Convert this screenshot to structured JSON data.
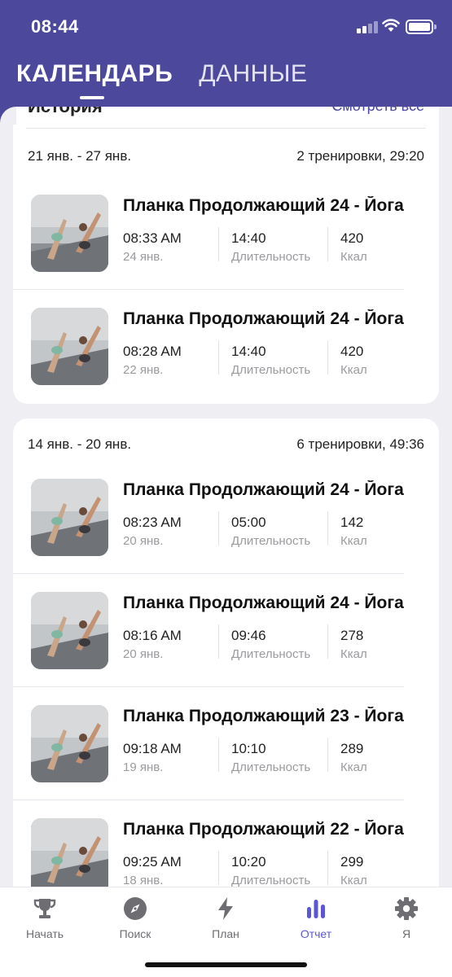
{
  "status_bar": {
    "time": "08:44"
  },
  "header": {
    "tabs": [
      {
        "label": "КАЛЕНДАРЬ",
        "active": true
      },
      {
        "label": "ДАННЫЕ",
        "active": false
      }
    ]
  },
  "history": {
    "title": "История",
    "link": "Смотреть все"
  },
  "weeks": [
    {
      "range": "21 янв. - 27 янв.",
      "summary": "2 тренировки, 29:20",
      "workouts": [
        {
          "title": "Планка Продолжающий 24 - Йога",
          "time": "08:33 AM",
          "date": "24 янв.",
          "duration": "14:40",
          "duration_label": "Длительность",
          "kcal": "420",
          "kcal_label": "Ккал"
        },
        {
          "title": "Планка Продолжающий 24 - Йога",
          "time": "08:28 AM",
          "date": "22 янв.",
          "duration": "14:40",
          "duration_label": "Длительность",
          "kcal": "420",
          "kcal_label": "Ккал"
        }
      ]
    },
    {
      "range": "14 янв. - 20 янв.",
      "summary": "6 тренировки, 49:36",
      "workouts": [
        {
          "title": "Планка Продолжающий 24 - Йога",
          "time": "08:23 AM",
          "date": "20 янв.",
          "duration": "05:00",
          "duration_label": "Длительность",
          "kcal": "142",
          "kcal_label": "Ккал"
        },
        {
          "title": "Планка Продолжающий 24 - Йога",
          "time": "08:16 AM",
          "date": "20 янв.",
          "duration": "09:46",
          "duration_label": "Длительность",
          "kcal": "278",
          "kcal_label": "Ккал"
        },
        {
          "title": "Планка Продолжающий 23 - Йога",
          "time": "09:18 AM",
          "date": "19 янв.",
          "duration": "10:10",
          "duration_label": "Длительность",
          "kcal": "289",
          "kcal_label": "Ккал"
        },
        {
          "title": "Планка Продолжающий 22 - Йога",
          "time": "09:25 AM",
          "date": "18 янв.",
          "duration": "10:20",
          "duration_label": "Длительность",
          "kcal": "299",
          "kcal_label": "Ккал"
        }
      ]
    }
  ],
  "tabbar": {
    "items": [
      {
        "label": "Начать",
        "icon": "trophy-icon",
        "active": false
      },
      {
        "label": "Поиск",
        "icon": "compass-icon",
        "active": false
      },
      {
        "label": "План",
        "icon": "lightning-icon",
        "active": false
      },
      {
        "label": "Отчет",
        "icon": "bar-chart-icon",
        "active": true
      },
      {
        "label": "Я",
        "icon": "gear-icon",
        "active": false
      }
    ]
  },
  "colors": {
    "header": "#4c489b",
    "accent": "#5b56d6",
    "background": "#eeeef3"
  }
}
